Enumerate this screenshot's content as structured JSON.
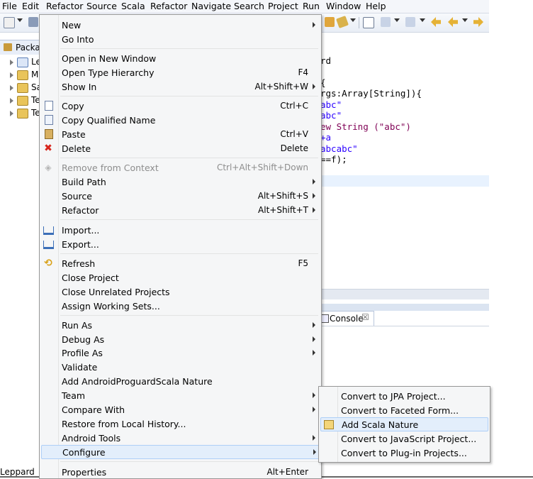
{
  "menubar": {
    "items": [
      "File",
      "Edit",
      "Refactor",
      "Source",
      "Scala",
      "Refactor",
      "Navigate",
      "Search",
      "Project",
      "Run",
      "Window",
      "Help"
    ]
  },
  "package_explorer": {
    "tab_label": "Packag",
    "tree_items": [
      "Le",
      "M",
      "Sa",
      "Te",
      "Te"
    ]
  },
  "editor": {
    "code_lines": [
      {
        "text": "rd",
        "kind": "plain"
      },
      {
        "text": "{",
        "kind": "plain"
      },
      {
        "text": "rgs:Array[String]){",
        "kind": "plain"
      },
      {
        "text": "abc\"",
        "kind": "str"
      },
      {
        "text": "abc\"",
        "kind": "str"
      },
      {
        "text": "ew String (\"abc\")",
        "kind": "mixed"
      },
      {
        "text": "+a",
        "kind": "str"
      },
      {
        "text": "abcabc\"",
        "kind": "str"
      },
      {
        "text": "==f);",
        "kind": "mixed"
      }
    ]
  },
  "console": {
    "tab_label": "Console",
    "close_glyph": "☒"
  },
  "status": {
    "label": "Leppard"
  },
  "context_menu": {
    "items": [
      {
        "label": "New",
        "shortcut": "",
        "submenu": true,
        "icon": "",
        "disabled": false
      },
      {
        "label": "Go Into",
        "shortcut": "",
        "submenu": false,
        "icon": "",
        "disabled": false
      },
      {
        "label": "Open in New Window",
        "shortcut": "",
        "submenu": false,
        "icon": "",
        "disabled": false
      },
      {
        "label": "Open Type Hierarchy",
        "shortcut": "F4",
        "submenu": false,
        "icon": "",
        "disabled": false
      },
      {
        "label": "Show In",
        "shortcut": "Alt+Shift+W",
        "submenu": true,
        "icon": "",
        "disabled": false
      },
      {
        "label": "Copy",
        "shortcut": "Ctrl+C",
        "submenu": false,
        "icon": "copy-icon",
        "disabled": false
      },
      {
        "label": "Copy Qualified Name",
        "shortcut": "",
        "submenu": false,
        "icon": "copy-qualified-icon",
        "disabled": false
      },
      {
        "label": "Paste",
        "shortcut": "Ctrl+V",
        "submenu": false,
        "icon": "paste-icon",
        "disabled": false
      },
      {
        "label": "Delete",
        "shortcut": "Delete",
        "submenu": false,
        "icon": "delete-icon",
        "disabled": false
      },
      {
        "label": "Remove from Context",
        "shortcut": "Ctrl+Alt+Shift+Down",
        "submenu": false,
        "icon": "remove-context-icon",
        "disabled": true
      },
      {
        "label": "Build Path",
        "shortcut": "",
        "submenu": true,
        "icon": "",
        "disabled": false
      },
      {
        "label": "Source",
        "shortcut": "Alt+Shift+S",
        "submenu": true,
        "icon": "",
        "disabled": false
      },
      {
        "label": "Refactor",
        "shortcut": "Alt+Shift+T",
        "submenu": true,
        "icon": "",
        "disabled": false
      },
      {
        "label": "Import...",
        "shortcut": "",
        "submenu": false,
        "icon": "import-icon",
        "disabled": false
      },
      {
        "label": "Export...",
        "shortcut": "",
        "submenu": false,
        "icon": "export-icon",
        "disabled": false
      },
      {
        "label": "Refresh",
        "shortcut": "F5",
        "submenu": false,
        "icon": "refresh-icon",
        "disabled": false
      },
      {
        "label": "Close Project",
        "shortcut": "",
        "submenu": false,
        "icon": "",
        "disabled": false
      },
      {
        "label": "Close Unrelated Projects",
        "shortcut": "",
        "submenu": false,
        "icon": "",
        "disabled": false
      },
      {
        "label": "Assign Working Sets...",
        "shortcut": "",
        "submenu": false,
        "icon": "",
        "disabled": false
      },
      {
        "label": "Run As",
        "shortcut": "",
        "submenu": true,
        "icon": "",
        "disabled": false
      },
      {
        "label": "Debug As",
        "shortcut": "",
        "submenu": true,
        "icon": "",
        "disabled": false
      },
      {
        "label": "Profile As",
        "shortcut": "",
        "submenu": true,
        "icon": "",
        "disabled": false
      },
      {
        "label": "Validate",
        "shortcut": "",
        "submenu": false,
        "icon": "",
        "disabled": false
      },
      {
        "label": "Add AndroidProguardScala Nature",
        "shortcut": "",
        "submenu": false,
        "icon": "",
        "disabled": false
      },
      {
        "label": "Team",
        "shortcut": "",
        "submenu": true,
        "icon": "",
        "disabled": false
      },
      {
        "label": "Compare With",
        "shortcut": "",
        "submenu": true,
        "icon": "",
        "disabled": false
      },
      {
        "label": "Restore from Local History...",
        "shortcut": "",
        "submenu": false,
        "icon": "",
        "disabled": false
      },
      {
        "label": "Android Tools",
        "shortcut": "",
        "submenu": true,
        "icon": "",
        "disabled": false
      },
      {
        "label": "Configure",
        "shortcut": "",
        "submenu": true,
        "icon": "",
        "disabled": false,
        "highlighted": true
      },
      {
        "label": "Properties",
        "shortcut": "Alt+Enter",
        "submenu": false,
        "icon": "",
        "disabled": false
      }
    ]
  },
  "configure_submenu": {
    "items": [
      {
        "label": "Convert to JPA Project...",
        "icon": ""
      },
      {
        "label": "Convert to Faceted Form...",
        "icon": ""
      },
      {
        "label": "Add Scala Nature",
        "icon": "scala-nature-icon",
        "highlighted": true
      },
      {
        "label": "Convert to JavaScript Project...",
        "icon": ""
      },
      {
        "label": "Convert to Plug-in Projects...",
        "icon": ""
      }
    ]
  },
  "colors": {
    "string_literal": "#2a00ff",
    "menu_bg": "#f5f6f7",
    "highlight_bg": "#e3eefb",
    "highlight_border": "#aecff7",
    "disabled_text": "#8d8d8d",
    "delete_icon_red": "#d8261c"
  }
}
